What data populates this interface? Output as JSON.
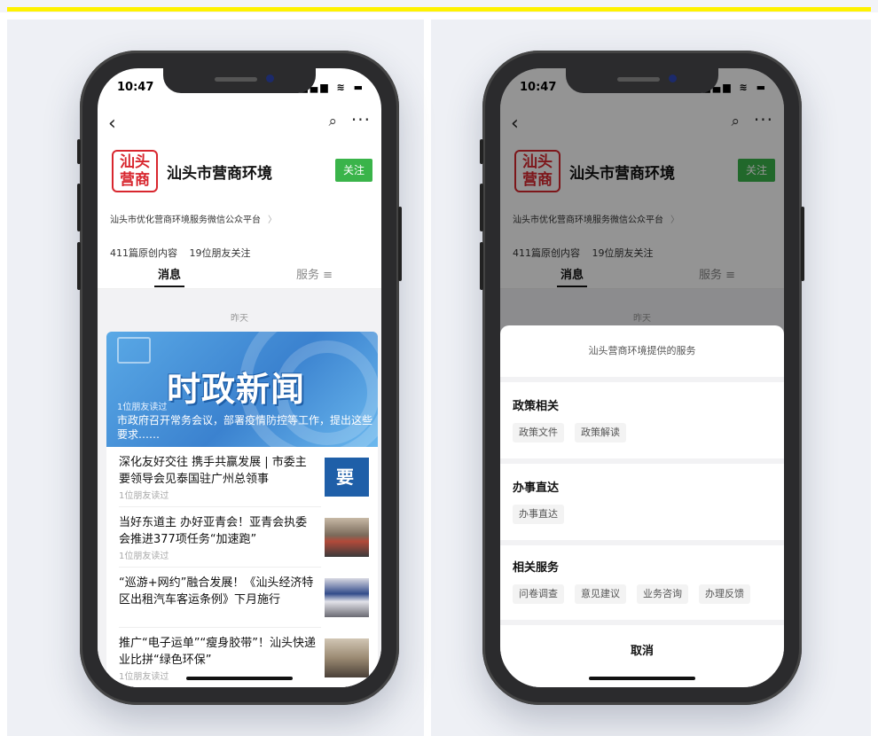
{
  "status_bar": {
    "time": "10:47",
    "icons": "▂▄▆ ≋ ▬"
  },
  "nav": {
    "back": "‹",
    "search": "⌕",
    "more": "···"
  },
  "account": {
    "logo_text": "汕头营商",
    "name": "汕头市营商环境",
    "follow_label": "关注",
    "description": "汕头市优化营商环境服务微信公众平台",
    "original_count": "411篇原创内容",
    "friends_following": "19位朋友关注"
  },
  "tabs": [
    {
      "label": "消息"
    },
    {
      "label": "服务 ≡"
    }
  ],
  "feed": {
    "date_label": "昨天",
    "banner": {
      "big_text": "时政新闻",
      "reads": "1位朋友读过",
      "headline": "市政府召开常务会议，部署疫情防控等工作，提出这些要求……"
    },
    "articles": [
      {
        "title": "深化友好交往 携手共赢发展 | 市委主要领导会见泰国驻广州总领事",
        "reads": "1位朋友读过",
        "thumb_text": "要 闻"
      },
      {
        "title": "当好东道主 办好亚青会！亚青会执委会推进377项任务“加速跑”",
        "reads": "1位朋友读过",
        "thumb_text": ""
      },
      {
        "title": "“巡游+网约”融合发展！《汕头经济特区出租汽车客运条例》下月施行",
        "reads": "",
        "thumb_text": ""
      },
      {
        "title": "推广“电子运单”“瘦身胶带”！汕头快递业比拼“绿色环保”",
        "reads": "1位朋友读过",
        "thumb_text": ""
      }
    ]
  },
  "service_sheet": {
    "title": "汕头营商环境提供的服务",
    "sections": [
      {
        "heading": "政策相关",
        "chips": [
          "政策文件",
          "政策解读"
        ]
      },
      {
        "heading": "办事直达",
        "chips": [
          "办事直达"
        ]
      },
      {
        "heading": "相关服务",
        "chips": [
          "问卷调查",
          "意见建议",
          "业务咨询",
          "办理反馈"
        ]
      }
    ],
    "cancel_label": "取消"
  },
  "colors": {
    "accent_yellow": "#fff200",
    "follow_green": "#3ab44a",
    "logo_red": "#d8262e"
  }
}
